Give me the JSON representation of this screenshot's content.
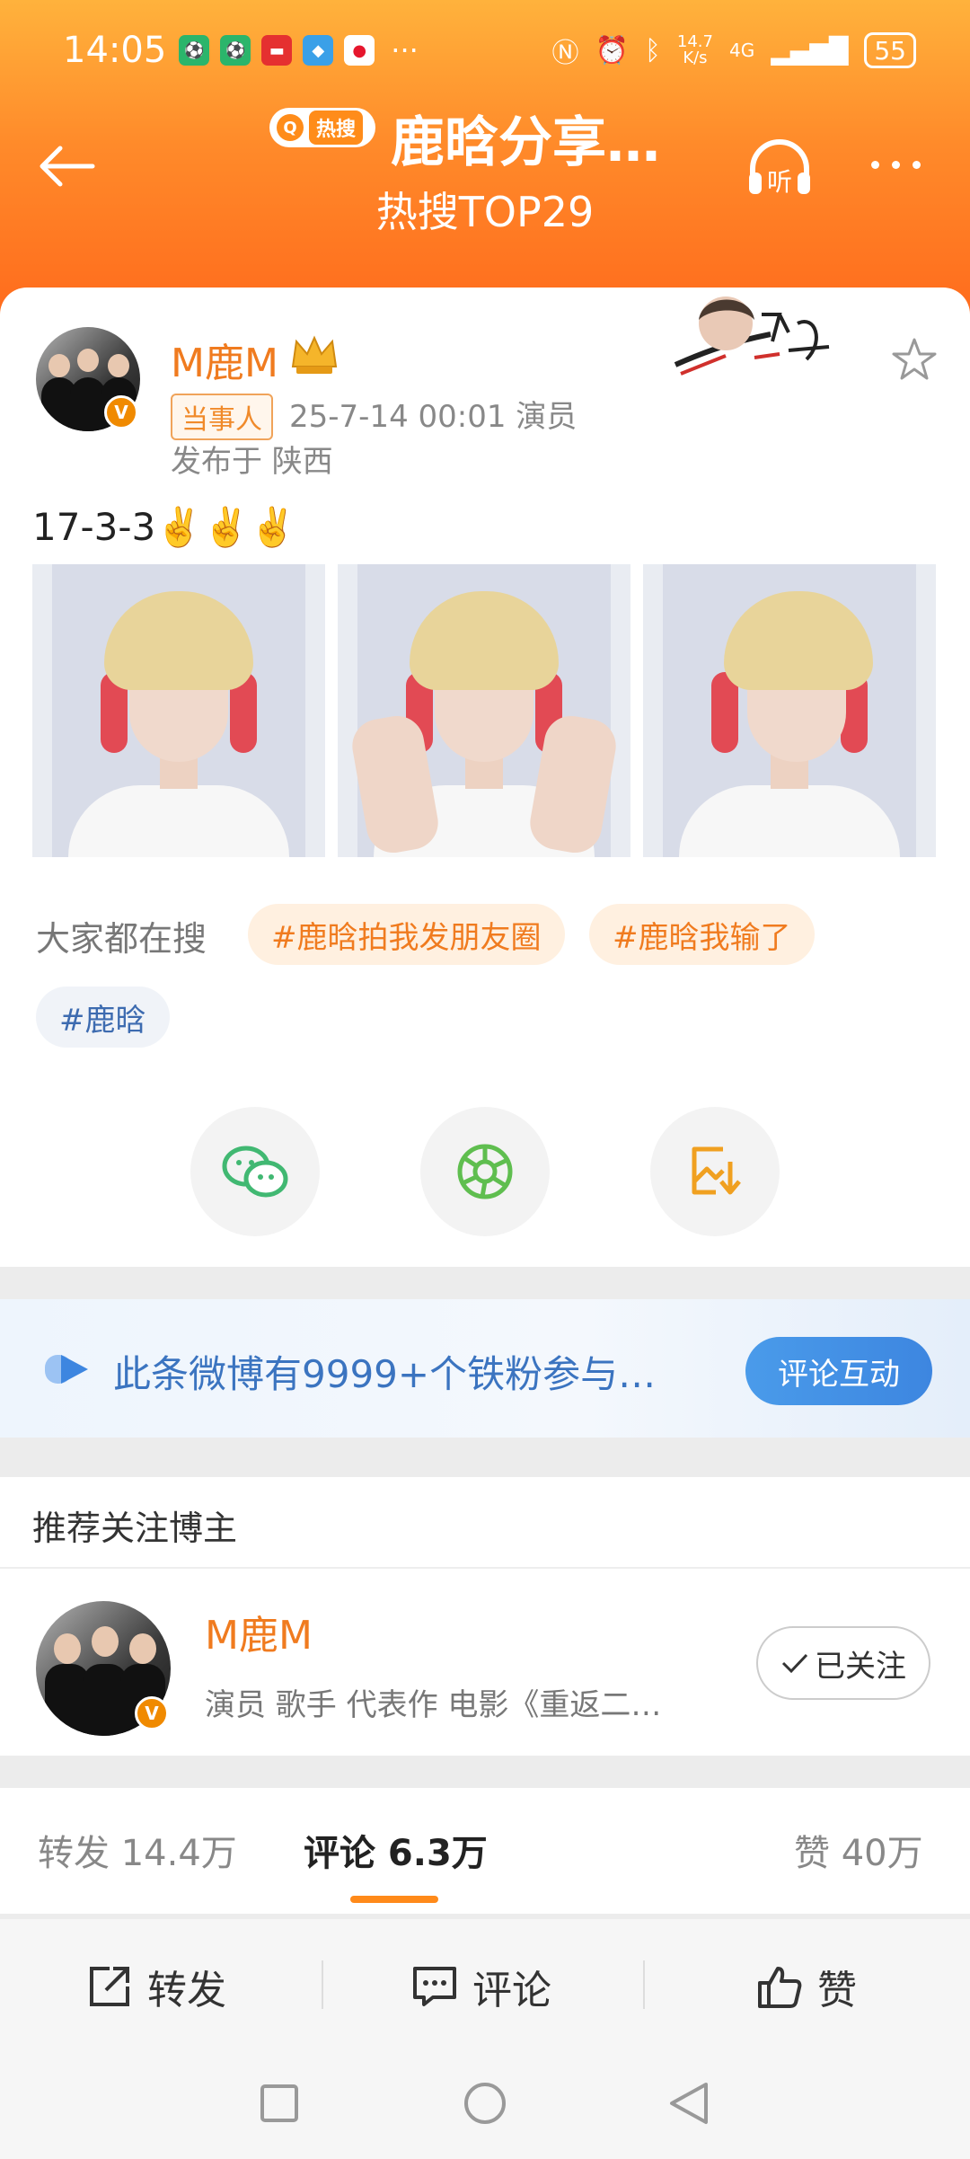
{
  "status_bar": {
    "time": "14:05",
    "net_speed": "14.7",
    "net_unit": "K/s",
    "network": "4G",
    "battery": "55"
  },
  "header": {
    "hot_label": "热搜",
    "title": "鹿晗分享…",
    "subtitle": "热搜TOP29",
    "listen_label": "听"
  },
  "post": {
    "author": "M鹿M",
    "party_tag": "当事人",
    "meta": "25-7-14 00:01  演员",
    "location": "发布于 陕西",
    "text": "17-3-3✌️✌️✌️",
    "verified_mark": "V"
  },
  "search": {
    "label": "大家都在搜",
    "tags": [
      "#鹿晗拍我发朋友圈",
      "#鹿晗我输了",
      "#鹿晗"
    ]
  },
  "fan_banner": {
    "text": "此条微博有9999+个铁粉参与…",
    "button": "评论互动"
  },
  "recommend": {
    "heading": "推荐关注博主",
    "name": "M鹿M",
    "desc": "演员 歌手 代表作 电影《重返二…",
    "follow_label": "已关注"
  },
  "counts": {
    "repost": "转发 14.4万",
    "comment": "评论 6.3万",
    "like": "赞 40万"
  },
  "actions": {
    "repost": "转发",
    "comment": "评论",
    "like": "赞"
  },
  "colors": {
    "accent": "#f07b1f",
    "header": "#ff7a22",
    "blue": "#3b74c0"
  }
}
